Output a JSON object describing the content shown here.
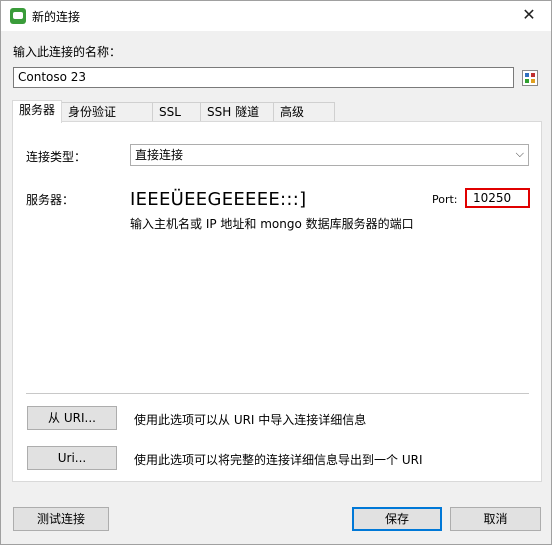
{
  "window": {
    "title": "新的连接",
    "close_glyph": "✕"
  },
  "name": {
    "label": "输入此连接的名称：",
    "value": "Contoso 23"
  },
  "tabs": [
    {
      "label": "服务器"
    },
    {
      "label": "身份验证"
    },
    {
      "label": "SSL"
    },
    {
      "label": "SSH 隧道"
    },
    {
      "label": "高级"
    }
  ],
  "server_tab": {
    "connection_type_label": "连接类型：",
    "connection_type_value": "直接连接",
    "server_label": "服务器：",
    "server_value": "IEEEÜEEGEEEEE:::]",
    "server_hint": "输入主机名或 IP 地址和 mongo 数据库服务器的端口",
    "port_label": "Port:",
    "port_value": "10250"
  },
  "uri": {
    "from_uri_button": "从 URI...",
    "from_uri_desc": "使用此选项可以从 URI 中导入连接详细信息",
    "uri_button": "Uri...",
    "uri_desc": "使用此选项可以将完整的连接详细信息导出到一个 URI"
  },
  "footer": {
    "test_button": "测试连接",
    "save_button": "保存",
    "cancel_button": "取消"
  },
  "colors": {
    "port_highlight": "#e00000",
    "primary_border": "#0078d7",
    "app_icon": "#3a9c3a"
  }
}
